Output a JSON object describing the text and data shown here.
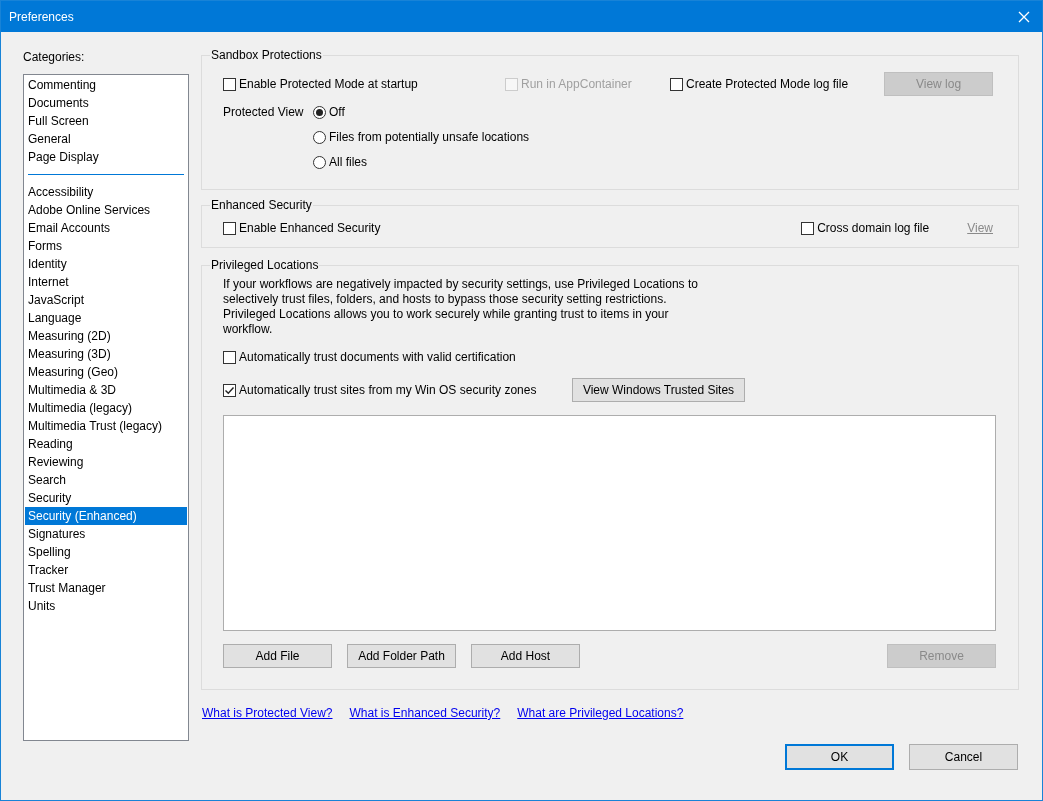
{
  "window": {
    "title": "Preferences"
  },
  "categories": {
    "label": "Categories:",
    "groups": [
      [
        {
          "label": "Commenting",
          "selected": false
        },
        {
          "label": "Documents",
          "selected": false
        },
        {
          "label": "Full Screen",
          "selected": false
        },
        {
          "label": "General",
          "selected": false
        },
        {
          "label": "Page Display",
          "selected": false
        }
      ],
      [
        {
          "label": "Accessibility",
          "selected": false
        },
        {
          "label": "Adobe Online Services",
          "selected": false
        },
        {
          "label": "Email Accounts",
          "selected": false
        },
        {
          "label": "Forms",
          "selected": false
        },
        {
          "label": "Identity",
          "selected": false
        },
        {
          "label": "Internet",
          "selected": false
        },
        {
          "label": "JavaScript",
          "selected": false
        },
        {
          "label": "Language",
          "selected": false
        },
        {
          "label": "Measuring (2D)",
          "selected": false
        },
        {
          "label": "Measuring (3D)",
          "selected": false
        },
        {
          "label": "Measuring (Geo)",
          "selected": false
        },
        {
          "label": "Multimedia & 3D",
          "selected": false
        },
        {
          "label": "Multimedia (legacy)",
          "selected": false
        },
        {
          "label": "Multimedia Trust (legacy)",
          "selected": false
        },
        {
          "label": "Reading",
          "selected": false
        },
        {
          "label": "Reviewing",
          "selected": false
        },
        {
          "label": "Search",
          "selected": false
        },
        {
          "label": "Security",
          "selected": false
        },
        {
          "label": "Security (Enhanced)",
          "selected": true
        },
        {
          "label": "Signatures",
          "selected": false
        },
        {
          "label": "Spelling",
          "selected": false
        },
        {
          "label": "Tracker",
          "selected": false
        },
        {
          "label": "Trust Manager",
          "selected": false
        },
        {
          "label": "Units",
          "selected": false
        }
      ]
    ]
  },
  "sandbox": {
    "title": "Sandbox Protections",
    "controls": [
      {
        "kind": "checkbox",
        "label": "Enable Protected Mode at startup",
        "checked": false,
        "disabled": false
      },
      {
        "kind": "checkbox",
        "label": "Run in AppContainer",
        "checked": false,
        "disabled": true
      },
      {
        "kind": "checkbox",
        "label": "Create Protected Mode log file",
        "checked": false,
        "disabled": false
      },
      {
        "kind": "button",
        "label": "View log",
        "disabled": true
      }
    ],
    "protected_view": {
      "label": "Protected View",
      "options": [
        {
          "label": "Off",
          "selected": true
        },
        {
          "label": "Files from potentially unsafe locations",
          "selected": false
        },
        {
          "label": "All files",
          "selected": false
        }
      ]
    }
  },
  "enhanced": {
    "title": "Enhanced Security",
    "controls": [
      {
        "kind": "checkbox",
        "label": "Enable Enhanced Security",
        "checked": false,
        "disabled": false
      },
      {
        "kind": "checkbox",
        "label": "Cross domain log file",
        "checked": false,
        "disabled": false
      },
      {
        "kind": "link",
        "label": "View",
        "disabled": true
      }
    ]
  },
  "privileged": {
    "title": "Privileged Locations",
    "description": "If your workflows are negatively impacted by security settings, use Privileged Locations to selectively trust files, folders, and hosts to bypass those security setting restrictions. Privileged Locations allows you to work securely while granting trust to items in your workflow.",
    "checkboxes": [
      {
        "label": "Automatically trust documents with valid certification",
        "checked": false
      },
      {
        "label": "Automatically trust sites from my Win OS security zones",
        "checked": true
      }
    ],
    "trusted_sites_button": "View Windows Trusted Sites",
    "buttons": [
      {
        "label": "Add File",
        "disabled": false
      },
      {
        "label": "Add Folder Path",
        "disabled": false
      },
      {
        "label": "Add Host",
        "disabled": false
      },
      {
        "label": "Remove",
        "disabled": true
      }
    ]
  },
  "help_links": [
    "What is Protected View?",
    "What is Enhanced Security?",
    "What are Privileged Locations?"
  ],
  "footer_buttons": [
    {
      "label": "OK",
      "default": true
    },
    {
      "label": "Cancel",
      "default": false
    }
  ]
}
